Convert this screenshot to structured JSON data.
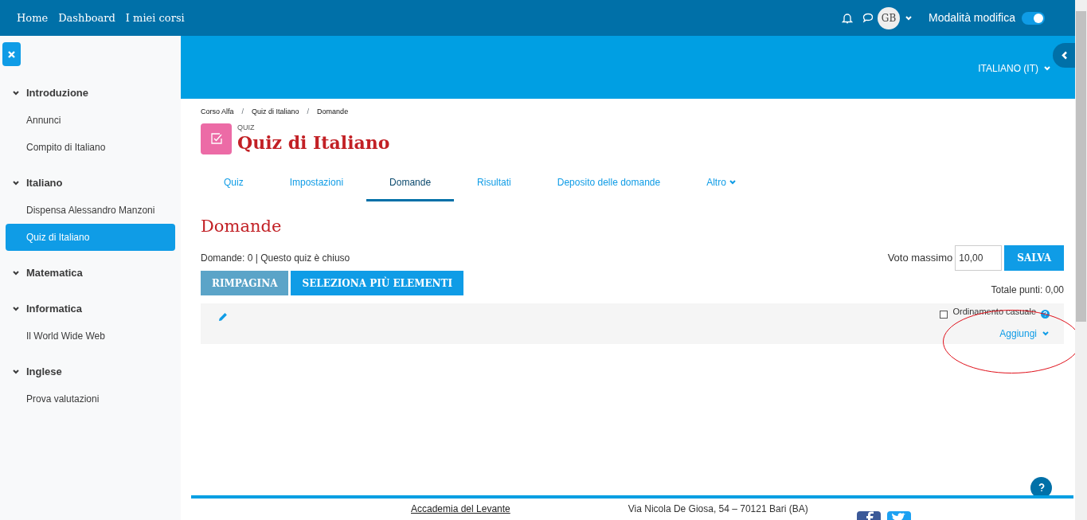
{
  "navbar": {
    "links": [
      "Home",
      "Dashboard",
      "I miei corsi"
    ],
    "avatar": "GB",
    "edit_mode": {
      "label": "Modalità modifica",
      "on": true
    }
  },
  "sidebar": {
    "sections": [
      {
        "title": "Introduzione",
        "expanded": true,
        "items": [
          {
            "label": "Annunci",
            "selected": false
          },
          {
            "label": "Compito di Italiano",
            "selected": false
          }
        ]
      },
      {
        "title": "Italiano",
        "expanded": true,
        "items": [
          {
            "label": "Dispensa Alessandro Manzoni",
            "selected": false
          },
          {
            "label": "Quiz di Italiano",
            "selected": true
          }
        ]
      },
      {
        "title": "Matematica",
        "expanded": true
      },
      {
        "title": "Informatica",
        "expanded": true,
        "items": [
          {
            "label": "Il World Wide Web",
            "selected": false
          }
        ]
      },
      {
        "title": "Inglese",
        "expanded": true,
        "items": [
          {
            "label": "Prova valutazioni",
            "selected": false
          }
        ]
      }
    ]
  },
  "language": "ITALIANO (IT)",
  "breadcrumb": [
    {
      "kind": "link",
      "text": "Corso Alfa"
    },
    {
      "kind": "separator",
      "text": "/"
    },
    {
      "kind": "link",
      "text": "Quiz di Italiano"
    },
    {
      "kind": "separator",
      "text": "/"
    },
    {
      "kind": "link",
      "text": "Domande"
    }
  ],
  "activity": {
    "type": "QUIZ",
    "title": "Quiz di Italiano"
  },
  "tabs": [
    {
      "label": "Quiz",
      "selected": false,
      "dropdown": false
    },
    {
      "label": "Impostazioni",
      "selected": false,
      "dropdown": false
    },
    {
      "label": "Domande",
      "selected": true,
      "dropdown": false
    },
    {
      "label": "Risultati",
      "selected": false,
      "dropdown": false
    },
    {
      "label": "Deposito delle domande",
      "selected": false,
      "dropdown": false
    },
    {
      "label": "Altro",
      "selected": false,
      "dropdown": true
    }
  ],
  "heading": "Domande",
  "status": "Domande: 0 | Questo quiz è chiuso",
  "max_grade": {
    "label": "Voto massimo",
    "value": "10,00",
    "button": "SALVA"
  },
  "buttons": [
    {
      "label": "RIMPAGINA",
      "disabled": true
    },
    {
      "label": "SELEZIONA PIÙ ELEMENTI",
      "disabled": false
    }
  ],
  "total": "Totale punti: 0,00",
  "section": {
    "shuffle": {
      "label": "Ordinamento casuale",
      "checked": false
    },
    "add": "Aggiungi"
  },
  "footer": {
    "name": "Accademia del Levante",
    "address": "Via Nicola De Giosa, 54 – 70121 Bari (BA)"
  }
}
